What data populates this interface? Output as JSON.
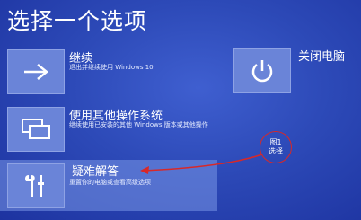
{
  "screen": {
    "title": "选择一个选项"
  },
  "options": {
    "continue": {
      "title": "继续",
      "desc": "退出并继续使用 Windows 10",
      "icon": "arrow-right-icon"
    },
    "other_os": {
      "title": "使用其他操作系统",
      "desc": "继续使用已安装的其他 Windows 版本或其他操作",
      "icon": "windows-icon"
    },
    "troubleshoot": {
      "title": "疑难解答",
      "desc": "重置你的电脑或查看高级选项",
      "icon": "tools-icon"
    },
    "shutdown": {
      "title": "关闭电脑",
      "icon": "power-icon"
    }
  },
  "annotation": {
    "line1": "图1",
    "line2": "选择",
    "color": "#d82828"
  }
}
